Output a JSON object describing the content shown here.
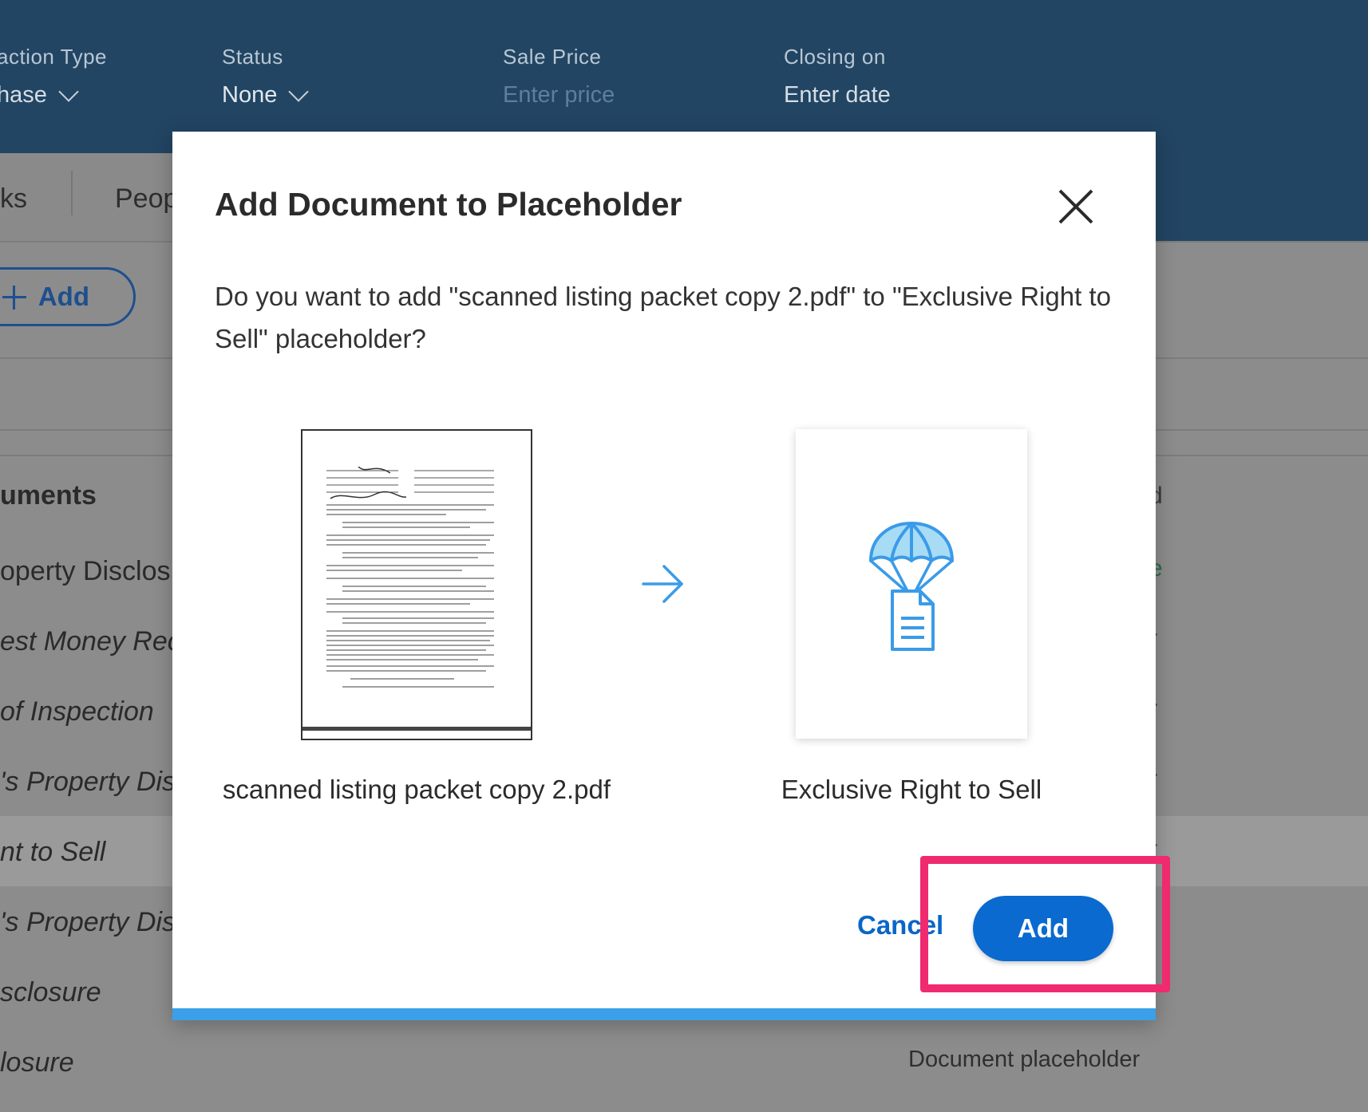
{
  "header": {
    "fields": [
      {
        "label": "action Type",
        "value": "hase"
      },
      {
        "label": "Status",
        "value": "None"
      },
      {
        "label": "Sale Price",
        "value": "Enter price"
      },
      {
        "label": "Closing on",
        "value": "Enter date"
      }
    ]
  },
  "tabs": [
    "ks",
    "Peop"
  ],
  "toolbar": {
    "add_label": "Add"
  },
  "documents": {
    "heading": "uments",
    "items": [
      "operty Disclos",
      "est Money Rec",
      "of Inspection",
      "'s Property Dis",
      "nt to Sell",
      "'s Property Dis",
      "sclosure",
      "losure"
    ],
    "right_fragments": [
      "d",
      "e",
      "r",
      "r",
      "r",
      "r"
    ],
    "placeholder_label": "Document placeholder"
  },
  "modal": {
    "title": "Add Document to Placeholder",
    "message": "Do you want to add \"scanned listing packet copy 2.pdf\" to \"Exclusive Right to Sell\" placeholder?",
    "source_name": "scanned listing packet copy 2.pdf",
    "target_name": "Exclusive Right to Sell",
    "cancel_label": "Cancel",
    "add_label": "Add"
  },
  "colors": {
    "header_bg": "#224563",
    "primary": "#0a6ad0",
    "highlight": "#f02a6e",
    "modal_bar": "#3aa0ea"
  },
  "icons": [
    "chevron-down-icon",
    "plus-icon",
    "close-icon",
    "arrow-right-icon",
    "parachute-document-icon"
  ]
}
